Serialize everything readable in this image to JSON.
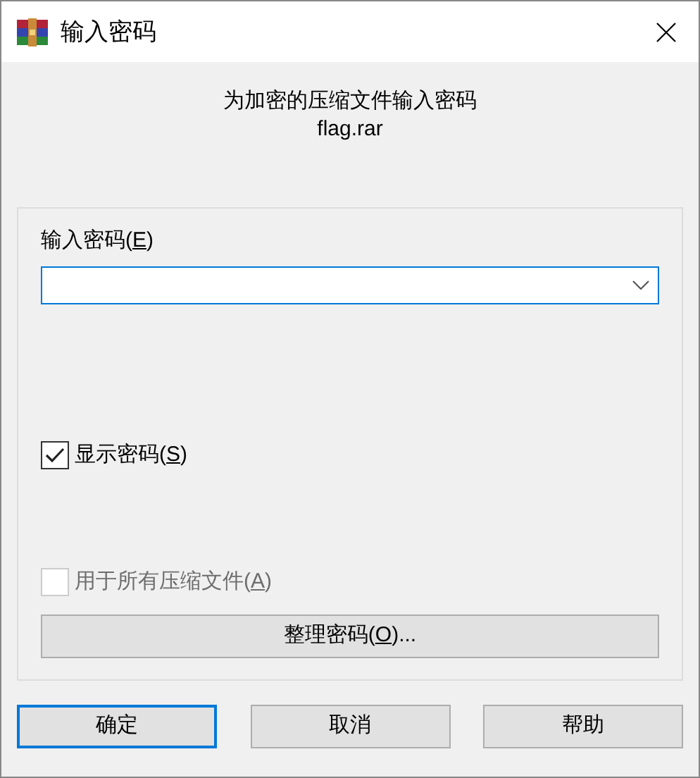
{
  "window": {
    "title": "输入密码"
  },
  "header": {
    "prompt": "为加密的压缩文件输入密码",
    "file_name": "flag.rar"
  },
  "password": {
    "label": {
      "before": "输入密码(",
      "key": "E",
      "after": ")"
    },
    "focused": true
  },
  "options": [
    {
      "label": {
        "before": "显示密码(",
        "key": "S",
        "after": ")"
      },
      "checked": true,
      "disabled": false
    },
    {
      "label": {
        "before": "用于所有压缩文件(",
        "key": "A",
        "after": ")"
      },
      "checked": false,
      "disabled": true
    }
  ],
  "organize_button": {
    "label": {
      "before": "整理密码(",
      "key": "O",
      "after": ")..."
    }
  },
  "buttons": [
    {
      "label": "确定",
      "default": true
    },
    {
      "label": "取消",
      "default": false
    },
    {
      "label": "帮助",
      "default": false
    }
  ]
}
